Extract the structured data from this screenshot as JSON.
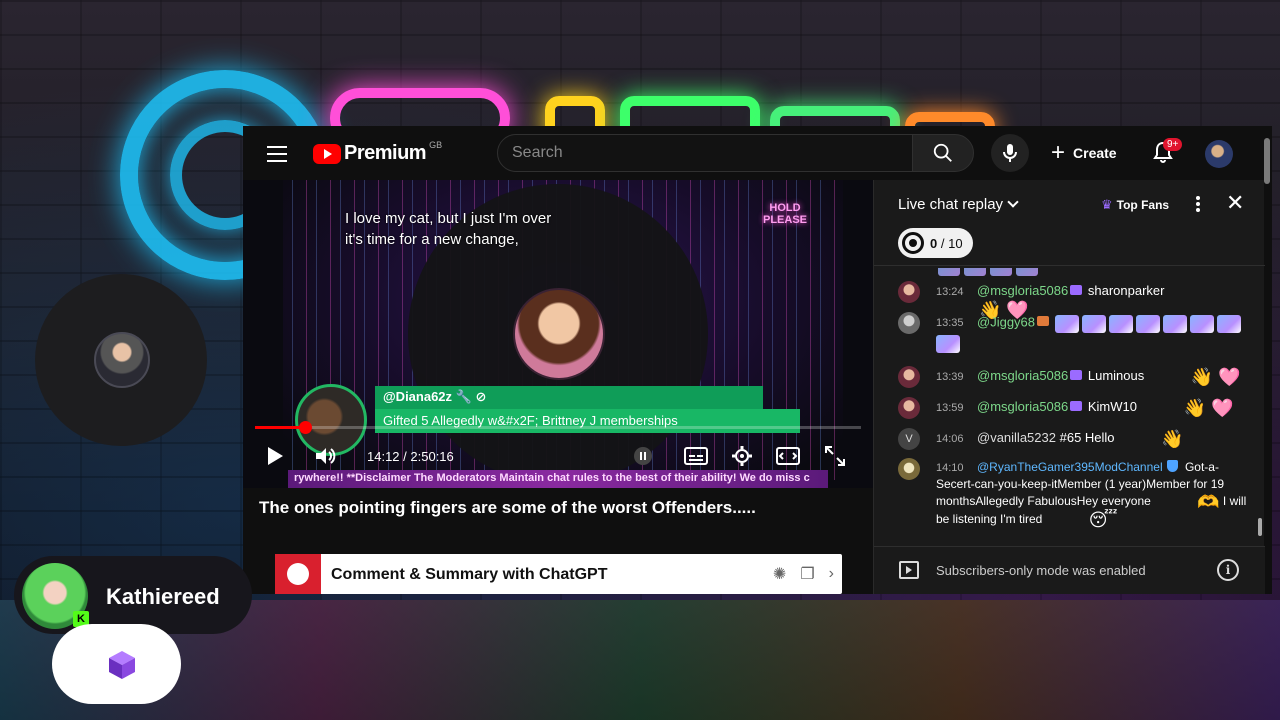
{
  "header": {
    "logo_text": "Premium",
    "logo_region": "GB",
    "search_placeholder": "Search",
    "create_label": "Create",
    "notification_count": "9+"
  },
  "video": {
    "caption": "I love my cat, but I just I'm over\nit's time for a new change,",
    "overlay_sign": "HOLD\nPLEASE",
    "gift_user": "@Diana62z",
    "gift_text": "Gifted 5 Allegedly w&#x2F; Brittney J memberships",
    "time_current": "14:12",
    "time_separator": " / ",
    "time_total": "2:50:16",
    "progress_fraction": 0.083,
    "ticker_text": "rywhere!! **Disclaimer The Moderators Maintain chat rules to the best of their ability! We do miss c",
    "title": "The ones pointing fingers are some of the worst Offenders....."
  },
  "chatgpt_bar": {
    "label": "Comment & Summary with ChatGPT"
  },
  "chat": {
    "title": "Live chat replay",
    "top_fans_label": "Top Fans",
    "goal_current": "0",
    "goal_total": "/ 10",
    "messages": [
      {
        "time": "13:24",
        "author": "@msgloria5086",
        "text": "sharonparker",
        "emotes": "👋 🩷"
      },
      {
        "time": "13:35",
        "author": "@Jiggy68",
        "text": "",
        "emotes": ""
      },
      {
        "time": "13:39",
        "author": "@msgloria5086",
        "text": "Luminous",
        "emotes": "👋 🩷"
      },
      {
        "time": "13:59",
        "author": "@msgloria5086",
        "text": "KimW10",
        "emotes": "👋 🩷"
      },
      {
        "time": "14:06",
        "author": "@vanilla5232",
        "text": "#65 Hello",
        "emotes": "👋",
        "avatar_letter": "V"
      },
      {
        "time": "14:10",
        "author": "@RyanTheGamer395ModChannel",
        "text": "Got-a-Secert-can-you-keep-itMember (1 year)Member for 19 monthsAllegedly FabulousHey everyone",
        "text2": "I will be listening I'm tired",
        "emote_mid": "🫶",
        "emote_end": "😴"
      }
    ],
    "footer_text": "Subscribers-only mode was enabled"
  },
  "overlay": {
    "viewer_name": "Kathiereed",
    "kick_letter": "K"
  },
  "colors": {
    "youtube_red": "#ff0000",
    "gift_green": "#18b765",
    "author_blue": "#5fb8ff",
    "kick_green": "#53fc18"
  }
}
